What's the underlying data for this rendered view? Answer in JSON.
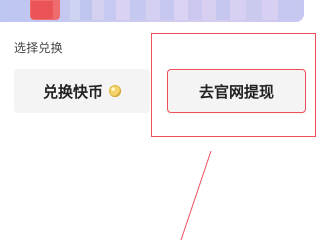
{
  "screen": {
    "section_title": "选择兑换",
    "options": {
      "coins_label": "兑换快币",
      "withdraw_label": "去官网提现"
    }
  },
  "colors": {
    "highlight": "#ef4f59",
    "option_bg": "#f4f4f4",
    "text": "#222222",
    "muted_text": "#444444",
    "coin": "#f3d36c"
  },
  "icons": {
    "coin": "coin-icon"
  }
}
